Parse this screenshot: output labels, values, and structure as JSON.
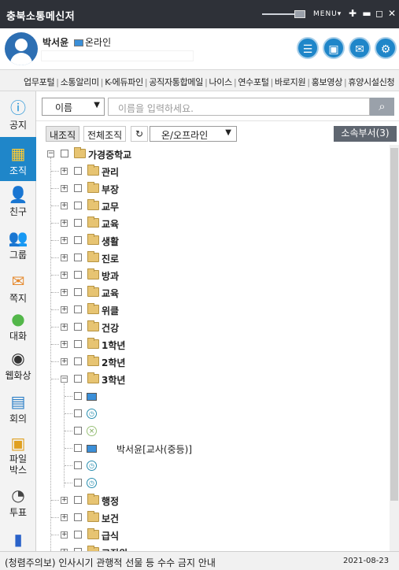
{
  "app": {
    "title": "충북소통메신저",
    "menu_label": "MENU▾"
  },
  "profile": {
    "name": "박서윤",
    "status": "온라인"
  },
  "links": [
    "업무포털",
    "소통알리미",
    "K-에듀파인",
    "공직자통합메일",
    "나이스",
    "연수포털",
    "바로지원",
    "홍보영상",
    "휴양시설신청"
  ],
  "sidebar": [
    {
      "label": "공지",
      "icon": "info-icon"
    },
    {
      "label": "조직",
      "icon": "org-icon"
    },
    {
      "label": "친구",
      "icon": "friend-icon"
    },
    {
      "label": "그룹",
      "icon": "group-icon"
    },
    {
      "label": "쪽지",
      "icon": "envelope-icon"
    },
    {
      "label": "대화",
      "icon": "chat-icon"
    },
    {
      "label": "웹화상",
      "icon": "video-icon"
    },
    {
      "label": "회의",
      "icon": "meeting-icon"
    },
    {
      "label": "파일\n박스",
      "icon": "box-icon"
    },
    {
      "label": "투표",
      "icon": "pie-icon"
    },
    {
      "label": "",
      "icon": "chart-icon"
    }
  ],
  "search": {
    "field": "이름",
    "placeholder": "이름을 입력하세요."
  },
  "tabs": {
    "mine": "내조직",
    "all": "전체조직",
    "filter": "온/오프라인",
    "dept": "소속부서(3)"
  },
  "tree": {
    "root": "가경중학교",
    "folders": [
      "관리",
      "부장",
      "교무",
      "교육",
      "생활",
      "진로",
      "방과",
      "교육",
      "위클",
      "건강",
      "1학년",
      "2학년",
      "3학년"
    ],
    "members": [
      {
        "status": "online",
        "name": ""
      },
      {
        "status": "away",
        "name": ""
      },
      {
        "status": "offline",
        "name": ""
      },
      {
        "status": "online",
        "name": "박서윤[교사(중등)]"
      },
      {
        "status": "away",
        "name": ""
      },
      {
        "status": "away",
        "name": ""
      }
    ],
    "after": [
      "행정",
      "보건",
      "급식",
      "교직원"
    ]
  },
  "status": {
    "notice": "(청렴주의보) 인사시기 관행적 선물 등 수수 금지 안내",
    "date": "2021-08-23"
  }
}
